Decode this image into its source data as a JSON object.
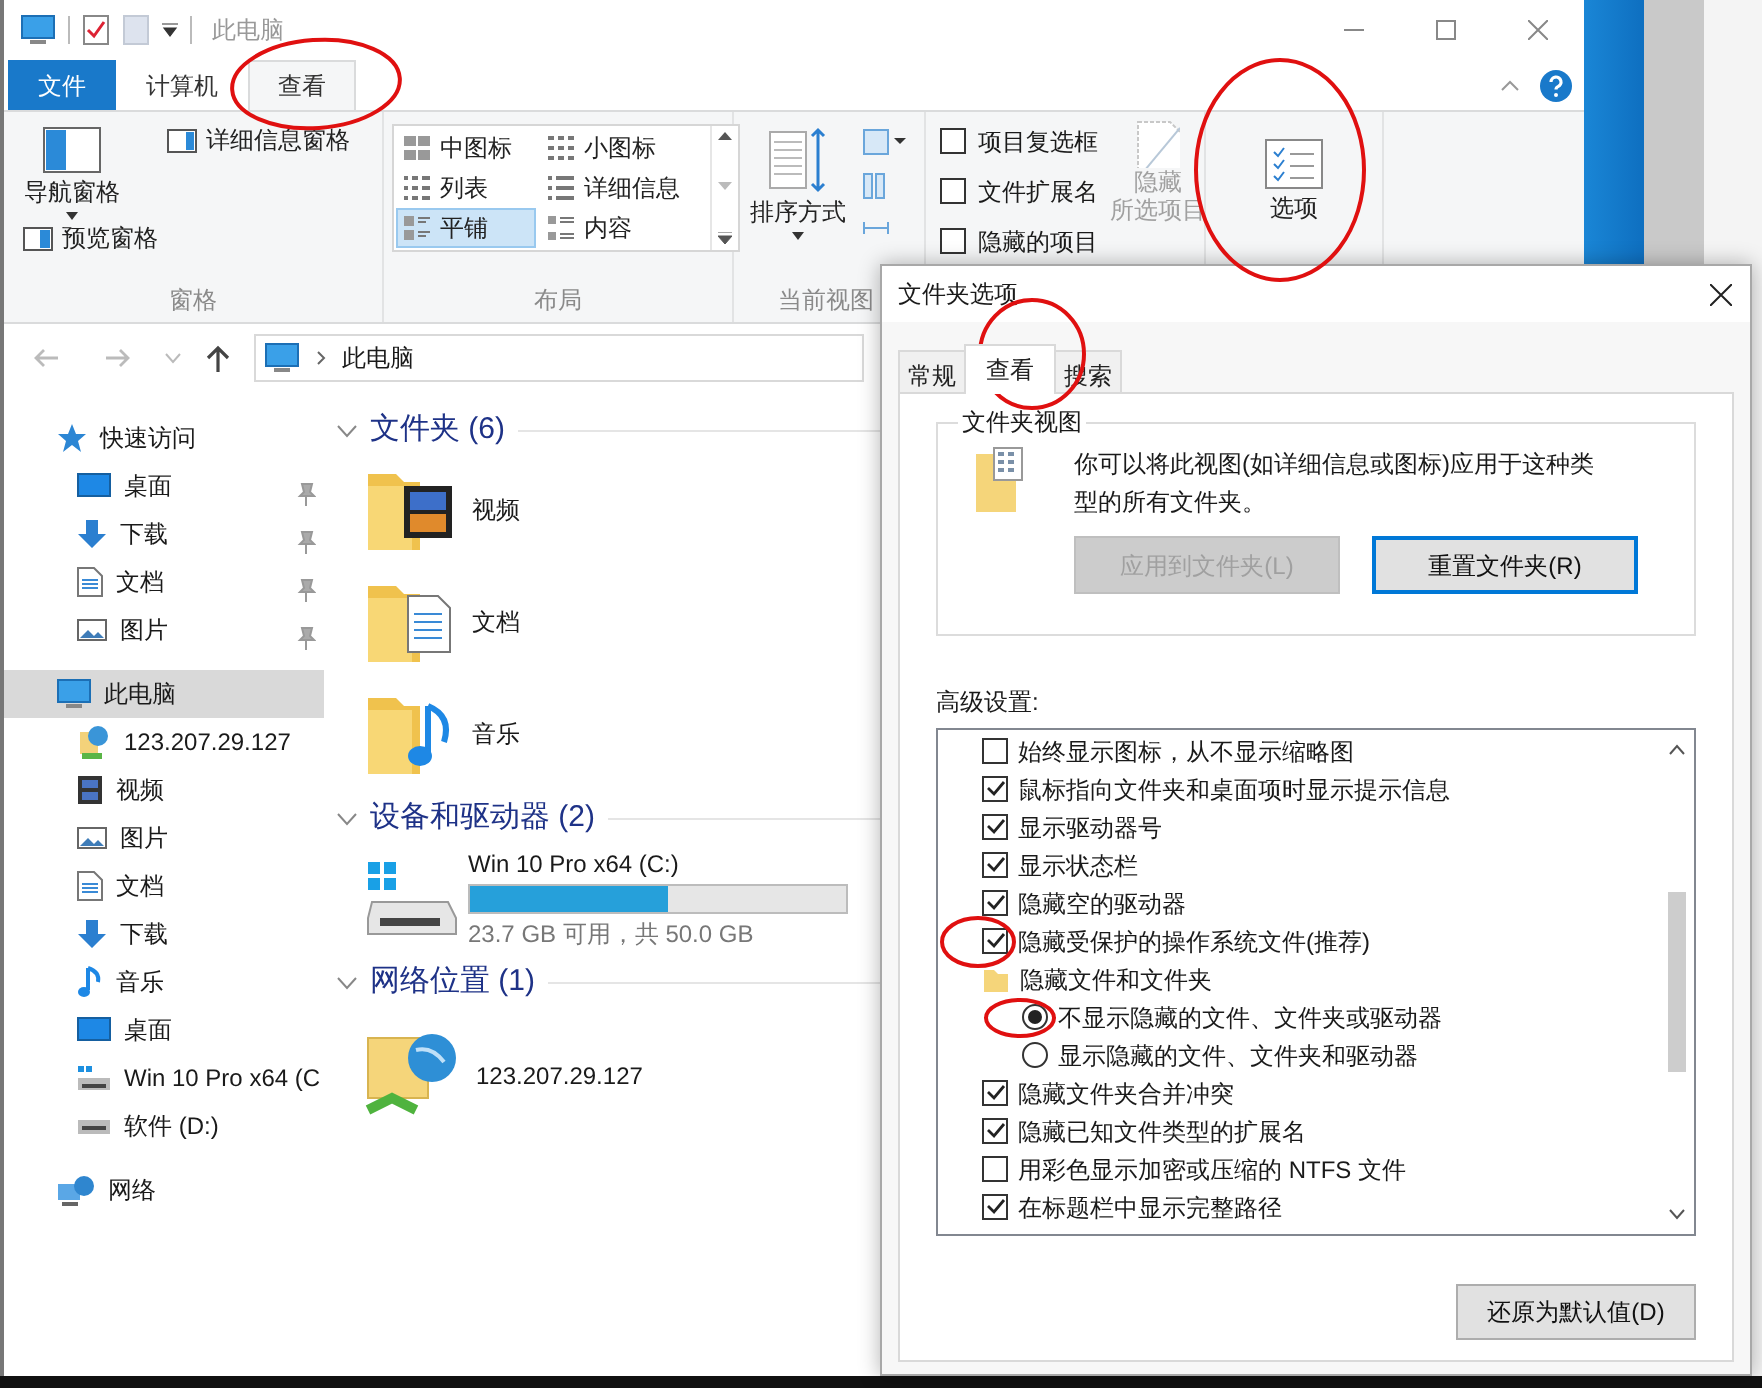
{
  "window": {
    "title": "此电脑"
  },
  "ribbon_tabs": [
    {
      "label": "文件",
      "kind": "file",
      "selected": false
    },
    {
      "label": "计算机",
      "kind": "tab",
      "selected": false
    },
    {
      "label": "查看",
      "kind": "tab",
      "selected": true
    }
  ],
  "panes_group": {
    "label": "窗格",
    "navigation_pane": "导航窗格",
    "preview_pane": "预览窗格",
    "details_pane": "详细信息窗格"
  },
  "layout_group": {
    "label": "布局",
    "options": [
      {
        "label": "中图标",
        "selected": false
      },
      {
        "label": "小图标",
        "selected": false
      },
      {
        "label": "列表",
        "selected": false
      },
      {
        "label": "详细信息",
        "selected": false
      },
      {
        "label": "平铺",
        "selected": true
      },
      {
        "label": "内容",
        "selected": false
      }
    ]
  },
  "current_view_group": {
    "label": "当前视图",
    "sort_button": "排序方式"
  },
  "show_hide_group": {
    "options": [
      {
        "label": "项目复选框",
        "checked": false
      },
      {
        "label": "文件扩展名",
        "checked": false
      },
      {
        "label": "隐藏的项目",
        "checked": false
      }
    ],
    "hide_selected": {
      "lines": [
        "隐藏",
        "所选项目"
      ],
      "disabled": true
    }
  },
  "options_button": "选项",
  "address": {
    "path": "此电脑"
  },
  "nav_tree": [
    {
      "label": "快速访问",
      "kind": "star",
      "selected": false,
      "children": [
        {
          "label": "桌面",
          "kind": "desktop",
          "pinned": true,
          "selected": false
        },
        {
          "label": "下载",
          "kind": "download",
          "pinned": true,
          "selected": false
        },
        {
          "label": "文档",
          "kind": "document",
          "pinned": true,
          "selected": false
        },
        {
          "label": "图片",
          "kind": "picture",
          "pinned": true,
          "selected": false
        }
      ]
    },
    {
      "label": "此电脑",
      "kind": "computer",
      "selected": true,
      "children": [
        {
          "label": "123.207.29.127",
          "kind": "network-location",
          "selected": false
        },
        {
          "label": "视频",
          "kind": "video",
          "selected": false
        },
        {
          "label": "图片",
          "kind": "picture",
          "selected": false
        },
        {
          "label": "文档",
          "kind": "document",
          "selected": false
        },
        {
          "label": "下载",
          "kind": "download",
          "selected": false
        },
        {
          "label": "音乐",
          "kind": "music",
          "selected": false
        },
        {
          "label": "桌面",
          "kind": "desktop",
          "selected": false
        },
        {
          "label": "Win 10 Pro x64 (C",
          "kind": "system-drive",
          "selected": false
        },
        {
          "label": "软件 (D:)",
          "kind": "drive",
          "selected": false
        }
      ]
    },
    {
      "label": "网络",
      "kind": "network",
      "selected": false
    }
  ],
  "sections": [
    {
      "title": "文件夹 (6)",
      "kind": "folders",
      "items": [
        {
          "label": "视频",
          "kind": "video"
        },
        {
          "label": "文档",
          "kind": "document"
        },
        {
          "label": "音乐",
          "kind": "music"
        }
      ]
    },
    {
      "title": "设备和驱动器 (2)",
      "kind": "drives",
      "items": [
        {
          "label": "Win 10 Pro x64 (C:)",
          "level": 0.526,
          "space": "23.7 GB 可用，共 50.0 GB"
        }
      ]
    },
    {
      "title": "网络位置 (1)",
      "kind": "network",
      "items": [
        {
          "label": "123.207.29.127"
        }
      ]
    }
  ],
  "dialog": {
    "title": "文件夹选项",
    "tabs": [
      {
        "label": "常规",
        "selected": false
      },
      {
        "label": "查看",
        "selected": true
      },
      {
        "label": "搜索",
        "selected": false
      }
    ],
    "folder_views": {
      "title": "文件夹视图",
      "description": "你可以将此视图(如详细信息或图标)应用于这种类型的所有文件夹。",
      "apply_button": {
        "label": "应用到文件夹(L)",
        "disabled": true
      },
      "reset_button": {
        "label": "重置文件夹(R)",
        "disabled": false
      }
    },
    "advanced_label": "高级设置:",
    "advanced_settings": [
      {
        "label": "始终显示图标，从不显示缩略图",
        "kind": "checkbox",
        "checked": false
      },
      {
        "label": "鼠标指向文件夹和桌面项时显示提示信息",
        "kind": "checkbox",
        "checked": true
      },
      {
        "label": "显示驱动器号",
        "kind": "checkbox",
        "checked": true
      },
      {
        "label": "显示状态栏",
        "kind": "checkbox",
        "checked": true
      },
      {
        "label": "隐藏空的驱动器",
        "kind": "checkbox",
        "checked": true
      },
      {
        "label": "隐藏受保护的操作系统文件(推荐)",
        "kind": "checkbox",
        "checked": true
      },
      {
        "label": "隐藏文件和文件夹",
        "kind": "folder",
        "children": [
          {
            "label": "不显示隐藏的文件、文件夹或驱动器",
            "kind": "radio",
            "selected": true
          },
          {
            "label": "显示隐藏的文件、文件夹和驱动器",
            "kind": "radio",
            "selected": false
          }
        ]
      },
      {
        "label": "隐藏文件夹合并冲突",
        "kind": "checkbox",
        "checked": true
      },
      {
        "label": "隐藏已知文件类型的扩展名",
        "kind": "checkbox",
        "checked": true
      },
      {
        "label": "用彩色显示加密或压缩的 NTFS 文件",
        "kind": "checkbox",
        "checked": false
      },
      {
        "label": "在标题栏中显示完整路径",
        "kind": "checkbox",
        "checked": true
      }
    ],
    "restore_button": "还原为默认值(D)"
  },
  "annotations": [
    {
      "kind": "ellipse"
    },
    {
      "kind": "ellipse"
    },
    {
      "kind": "ellipse"
    },
    {
      "kind": "ellipse"
    },
    {
      "kind": "ellipse"
    }
  ]
}
